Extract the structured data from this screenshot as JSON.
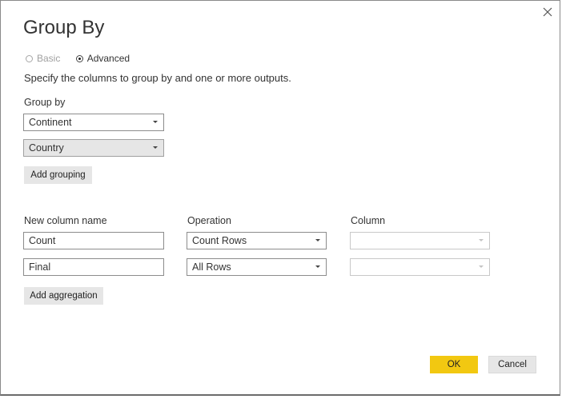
{
  "dialog": {
    "title": "Group By",
    "close_icon": "close-icon"
  },
  "mode": {
    "options": [
      {
        "label": "Basic",
        "selected": false,
        "enabled": false
      },
      {
        "label": "Advanced",
        "selected": true,
        "enabled": true
      }
    ]
  },
  "instructions": "Specify the columns to group by and one or more outputs.",
  "grouping": {
    "label": "Group by",
    "fields": [
      "Continent",
      "Country"
    ],
    "add_button": "Add grouping"
  },
  "aggregation": {
    "headers": {
      "new_column_name": "New column name",
      "operation": "Operation",
      "column": "Column"
    },
    "rows": [
      {
        "name": "Count",
        "operation": "Count Rows",
        "column": ""
      },
      {
        "name": "Final",
        "operation": "All Rows",
        "column": ""
      }
    ],
    "add_button": "Add aggregation"
  },
  "footer": {
    "ok_label": "OK",
    "cancel_label": "Cancel"
  },
  "colors": {
    "accent": "#f2c811",
    "button_grey": "#e6e6e6"
  }
}
